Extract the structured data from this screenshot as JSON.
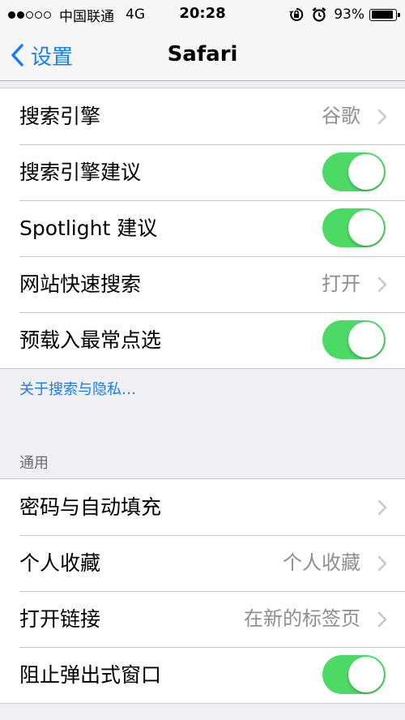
{
  "status_bar": {
    "carrier": "中国联通",
    "network": "4G",
    "time": "20:28",
    "battery_percent": "93%",
    "battery_level": 0.93,
    "signal_bars_filled": 2,
    "signal_bars_total": 5,
    "icons": [
      "rotation-lock-icon",
      "alarm-icon"
    ]
  },
  "nav": {
    "back_label": "设置",
    "title": "Safari"
  },
  "search_section": {
    "rows": [
      {
        "label": "搜索引擎",
        "value": "谷歌",
        "type": "disclosure"
      },
      {
        "label": "搜索引擎建议",
        "type": "toggle",
        "on": true
      },
      {
        "label": "Spotlight 建议",
        "type": "toggle",
        "on": true
      },
      {
        "label": "网站快速搜索",
        "value": "打开",
        "type": "disclosure"
      },
      {
        "label": "预载入最常点选",
        "type": "toggle",
        "on": true
      }
    ],
    "footer_link": "关于搜索与隐私…"
  },
  "general_section": {
    "header": "通用",
    "rows": [
      {
        "label": "密码与自动填充",
        "value": "",
        "type": "disclosure"
      },
      {
        "label": "个人收藏",
        "value": "个人收藏",
        "type": "disclosure"
      },
      {
        "label": "打开链接",
        "value": "在新的标签页",
        "type": "disclosure"
      },
      {
        "label": "阻止弹出式窗口",
        "type": "toggle",
        "on": true
      }
    ]
  },
  "colors": {
    "accent": "#157efb",
    "toggle_on": "#4cd964",
    "background": "#efeff4",
    "secondary_text": "#8e8e93"
  }
}
